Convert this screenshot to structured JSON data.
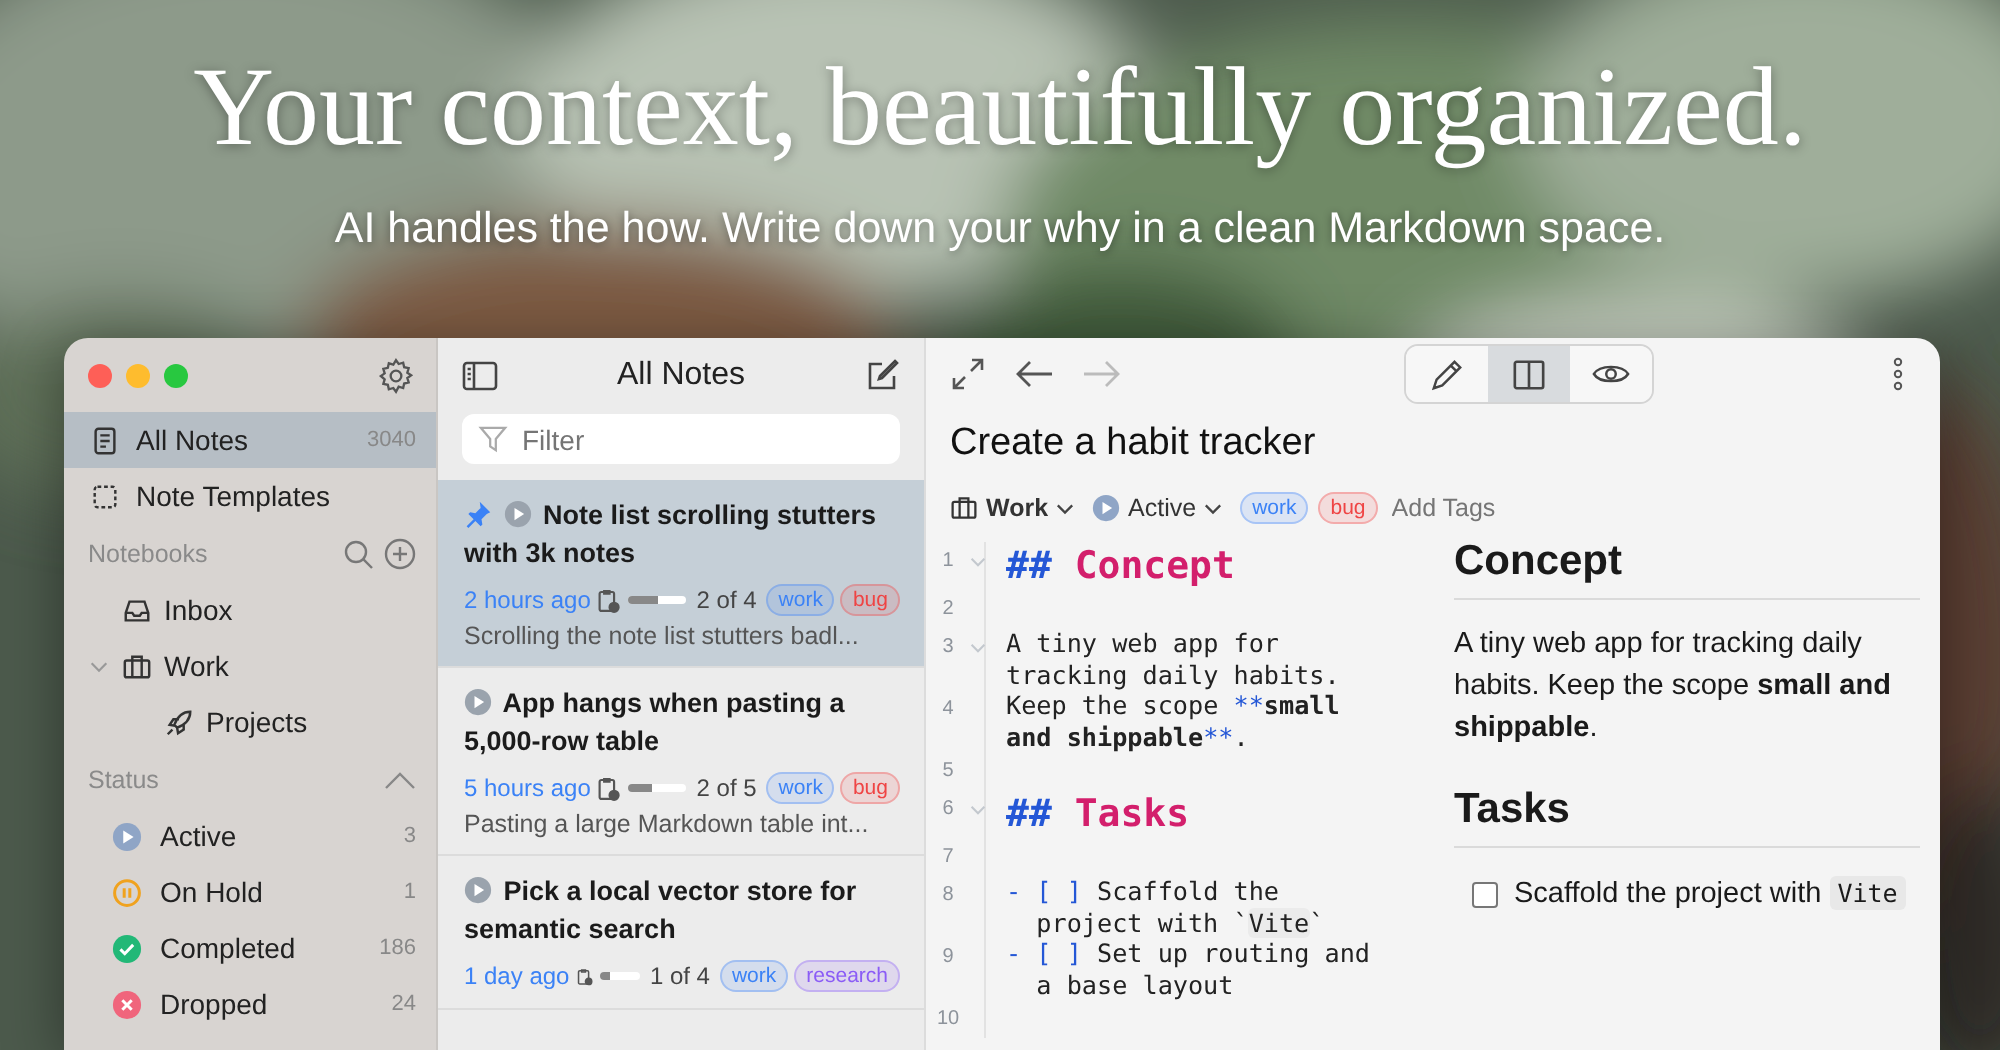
{
  "hero": {
    "title": "Your context, beautifully organized.",
    "subtitle": "AI handles the how. Write down your why in a clean Markdown space."
  },
  "sidebar": {
    "nav": [
      {
        "kind": "notes",
        "label": "All Notes",
        "count": "3040",
        "selected": true
      },
      {
        "kind": "templates",
        "label": "Note Templates",
        "selected": false
      }
    ],
    "notebooks": {
      "heading": "Notebooks",
      "items": [
        {
          "kind": "inbox",
          "label": "Inbox"
        },
        {
          "kind": "briefcase",
          "label": "Work",
          "expanded": true,
          "children": [
            {
              "kind": "rocket",
              "label": "Projects"
            }
          ]
        }
      ]
    },
    "status": {
      "heading": "Status",
      "expanded": true,
      "items": [
        {
          "kind": "active",
          "label": "Active",
          "count": "3",
          "color": "#8fa5c6"
        },
        {
          "kind": "hold",
          "label": "On Hold",
          "count": "1",
          "color": "#f0a21e"
        },
        {
          "kind": "completed",
          "label": "Completed",
          "count": "186",
          "color": "#22b877"
        },
        {
          "kind": "dropped",
          "label": "Dropped",
          "count": "24",
          "color": "#f0657c"
        }
      ]
    }
  },
  "note_list": {
    "title": "All Notes",
    "filter": {
      "placeholder": "Filter"
    },
    "notes": [
      {
        "selected": true,
        "pinned": true,
        "title": "Note list scrolling stutters with 3k notes",
        "time": "2 hours ago",
        "progress": {
          "level": 0.5,
          "text": "2 of 4"
        },
        "tags": [
          {
            "label": "work",
            "color": "#3b82f6"
          },
          {
            "label": "bug",
            "color": "#ef4444"
          }
        ],
        "excerpt": "Scrolling the note list stutters badl..."
      },
      {
        "selected": false,
        "pinned": false,
        "title": "App hangs when pasting a 5,000-row table",
        "time": "5 hours ago",
        "progress": {
          "level": 0.4,
          "text": "2 of 5"
        },
        "tags": [
          {
            "label": "work",
            "color": "#3b82f6"
          },
          {
            "label": "bug",
            "color": "#ef4444"
          }
        ],
        "excerpt": "Pasting a large Markdown table int..."
      },
      {
        "selected": false,
        "pinned": false,
        "title": "Pick a local vector store for semantic search",
        "time": "1 day ago",
        "progress": {
          "level": 0.25,
          "text": "1 of 4"
        },
        "tags": [
          {
            "label": "work",
            "color": "#3b82f6"
          },
          {
            "label": "research",
            "color": "#8b5cf6"
          }
        ]
      }
    ]
  },
  "editor": {
    "back": {
      "disabled": false
    },
    "forward": {
      "disabled": true
    },
    "view_modes": [
      {
        "kind": "edit",
        "selected": false
      },
      {
        "kind": "split",
        "selected": true
      },
      {
        "kind": "preview",
        "selected": false
      }
    ],
    "title": "Create a habit tracker",
    "notebook": "Work",
    "status": "Active",
    "tags": [
      {
        "label": "work",
        "color": "#3b82f6"
      },
      {
        "label": "bug",
        "color": "#ef4444"
      }
    ],
    "add_tags": {
      "placeholder": "Add Tags"
    },
    "source": [
      {
        "number": "1",
        "foldable": true,
        "kind": "heading",
        "segments": [
          {
            "kind": "mark",
            "text": "## "
          },
          {
            "kind": "heading",
            "text": "Concept"
          }
        ]
      },
      {
        "number": "2",
        "foldable": false,
        "kind": "blank"
      },
      {
        "number": "3",
        "foldable": true,
        "kind": "text",
        "segments": [
          {
            "kind": "plain",
            "text": "A tiny web app for tracking daily habits."
          }
        ]
      },
      {
        "number": "4",
        "foldable": false,
        "kind": "text",
        "segments": [
          {
            "kind": "plain",
            "text": "Keep the scope "
          },
          {
            "kind": "mark",
            "text": "**"
          },
          {
            "kind": "strong",
            "text": "small and shippable"
          },
          {
            "kind": "mark",
            "text": "**"
          },
          {
            "kind": "plain",
            "text": "."
          }
        ]
      },
      {
        "number": "5",
        "foldable": false,
        "kind": "blank"
      },
      {
        "number": "6",
        "foldable": true,
        "kind": "heading",
        "segments": [
          {
            "kind": "mark",
            "text": "## "
          },
          {
            "kind": "heading",
            "text": "Tasks"
          }
        ]
      },
      {
        "number": "7",
        "foldable": false,
        "kind": "blank"
      },
      {
        "number": "8",
        "foldable": false,
        "kind": "task",
        "segments": [
          {
            "kind": "mark",
            "text": "- [ ] "
          },
          {
            "kind": "plain",
            "text": "Scaffold the project with `"
          },
          {
            "kind": "code",
            "text": "Vite"
          },
          {
            "kind": "plain",
            "text": "`"
          }
        ]
      },
      {
        "number": "9",
        "foldable": false,
        "kind": "task",
        "segments": [
          {
            "kind": "mark",
            "text": "- [ ] "
          },
          {
            "kind": "plain",
            "text": "Set up routing and a base layout"
          }
        ]
      },
      {
        "number": "10",
        "foldable": false,
        "kind": "blank"
      }
    ],
    "preview": [
      {
        "kind": "heading",
        "text": "Concept"
      },
      {
        "kind": "paragraph",
        "text": "A tiny web app for tracking daily habits. Keep the scope **small and shippable**."
      },
      {
        "kind": "heading",
        "text": "Tasks"
      },
      {
        "kind": "task",
        "checked": false,
        "text": "Scaffold the project with",
        "code": "Vite"
      }
    ]
  }
}
